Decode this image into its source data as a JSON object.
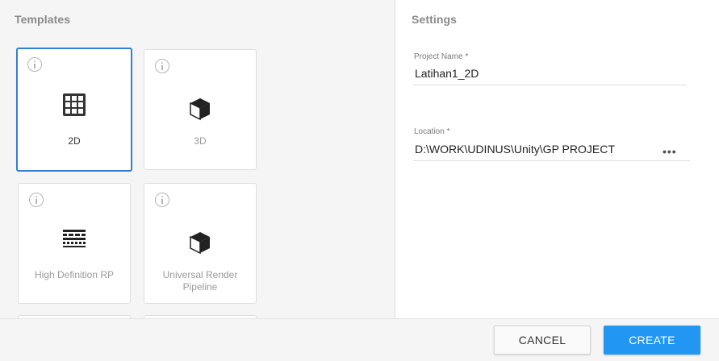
{
  "templates": {
    "title": "Templates",
    "cards": [
      {
        "label": "2D",
        "icon": "grid-icon",
        "selected": true
      },
      {
        "label": "3D",
        "icon": "cube-icon",
        "selected": false
      },
      {
        "label": "High Definition RP",
        "icon": "hdrp-icon",
        "selected": false
      },
      {
        "label": "Universal Render Pipeline",
        "icon": "cube-icon",
        "selected": false
      }
    ]
  },
  "settings": {
    "title": "Settings",
    "project_name": {
      "label": "Project Name *",
      "value": "Latihan1_2D"
    },
    "location": {
      "label": "Location *",
      "value": "D:\\WORK\\UDINUS\\Unity\\GP PROJECT",
      "browse": "•••"
    }
  },
  "footer": {
    "cancel_label": "CANCEL",
    "create_label": "CREATE"
  },
  "colors": {
    "accent": "#2196f3",
    "selected_border": "#2f7fd6"
  }
}
